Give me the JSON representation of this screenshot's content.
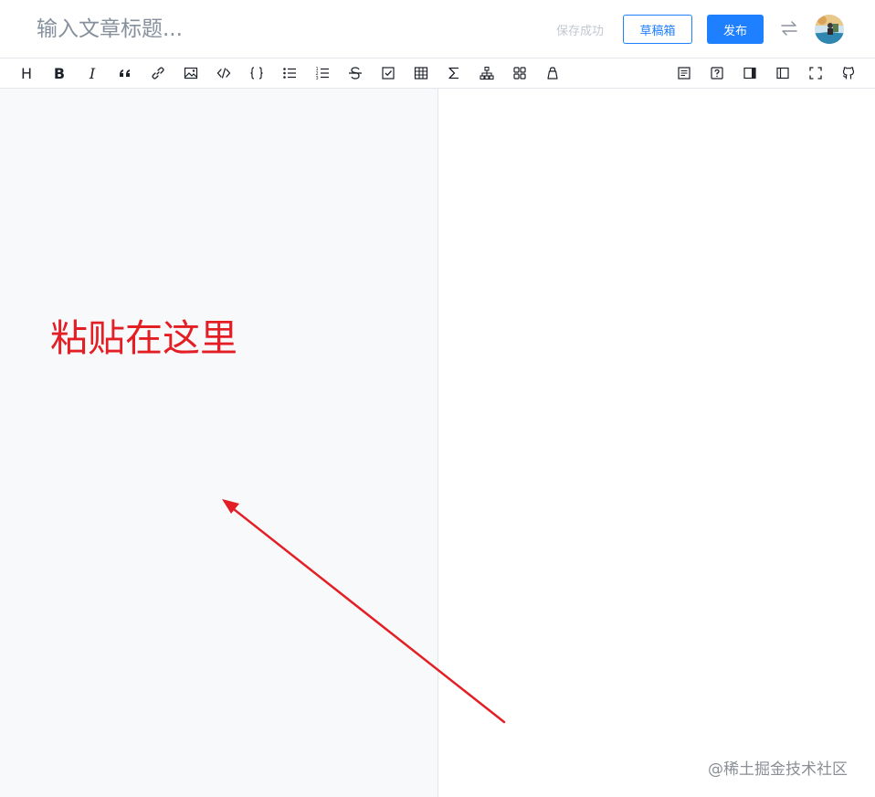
{
  "header": {
    "title_placeholder": "输入文章标题...",
    "save_status": "保存成功",
    "draft_button": "草稿箱",
    "publish_button": "发布",
    "switch_icon": "switch-arrows-icon",
    "avatar": "user-avatar"
  },
  "toolbar": {
    "left_items": [
      {
        "name": "heading",
        "icon": "H"
      },
      {
        "name": "bold",
        "icon": "B"
      },
      {
        "name": "italic",
        "icon": "I"
      },
      {
        "name": "quote",
        "icon": "quote-icon"
      },
      {
        "name": "link",
        "icon": "link-icon"
      },
      {
        "name": "image",
        "icon": "image-icon"
      },
      {
        "name": "code",
        "icon": "code-icon"
      },
      {
        "name": "code-block",
        "icon": "braces-icon"
      },
      {
        "name": "unordered-list",
        "icon": "bullet-list-icon"
      },
      {
        "name": "ordered-list",
        "icon": "ordered-list-icon"
      },
      {
        "name": "strikethrough",
        "icon": "strikethrough-icon"
      },
      {
        "name": "task-list",
        "icon": "checkbox-icon"
      },
      {
        "name": "table",
        "icon": "table-icon"
      },
      {
        "name": "formula",
        "icon": "sigma-icon"
      },
      {
        "name": "chart",
        "icon": "diagram-icon"
      },
      {
        "name": "plugins",
        "icon": "grid-icon"
      },
      {
        "name": "theme",
        "icon": "bag-icon"
      }
    ],
    "right_items": [
      {
        "name": "toc",
        "icon": "document-icon"
      },
      {
        "name": "help",
        "icon": "question-icon"
      },
      {
        "name": "preview-only",
        "icon": "right-panel-icon"
      },
      {
        "name": "editor-only",
        "icon": "left-panel-icon"
      },
      {
        "name": "fullscreen",
        "icon": "fullscreen-icon"
      },
      {
        "name": "github",
        "icon": "github-icon"
      }
    ]
  },
  "annotation": {
    "text": "粘贴在这里",
    "color": "#e31f25"
  },
  "watermark": "@稀土掘金技术社区",
  "colors": {
    "accent": "#1e80ff",
    "editor_bg": "#f8f9fb"
  }
}
